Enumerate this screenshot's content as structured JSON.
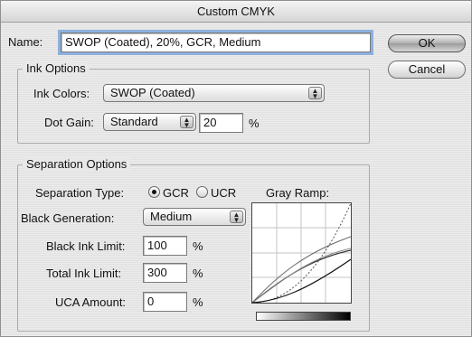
{
  "window": {
    "title": "Custom CMYK"
  },
  "name_field": {
    "label": "Name:",
    "value": "SWOP (Coated), 20%, GCR, Medium"
  },
  "buttons": {
    "ok": "OK",
    "cancel": "Cancel"
  },
  "ink_options": {
    "title": "Ink Options",
    "ink_colors_label": "Ink Colors:",
    "ink_colors_value": "SWOP (Coated)",
    "dot_gain_label": "Dot Gain:",
    "dot_gain_mode": "Standard",
    "dot_gain_value": "20",
    "dot_gain_unit": "%"
  },
  "separation_options": {
    "title": "Separation Options",
    "type_label": "Separation Type:",
    "gcr_label": "GCR",
    "ucr_label": "UCR",
    "selected_type": "GCR",
    "gray_ramp_label": "Gray Ramp:",
    "black_generation_label": "Black Generation:",
    "black_generation_value": "Medium",
    "black_ink_limit_label": "Black Ink Limit:",
    "black_ink_limit_value": "100",
    "total_ink_limit_label": "Total Ink Limit:",
    "total_ink_limit_value": "300",
    "uca_amount_label": "UCA Amount:",
    "uca_amount_value": "0",
    "percent_unit": "%"
  },
  "icons": {
    "popup_arrows": "up-down-arrows-icon",
    "radio_selected": "radio-selected-icon",
    "radio_unselected": "radio-unselected-icon"
  },
  "colors": {
    "focus_ring": "#8db0de",
    "curve_dark": "#111111",
    "curve_light": "#777777"
  }
}
